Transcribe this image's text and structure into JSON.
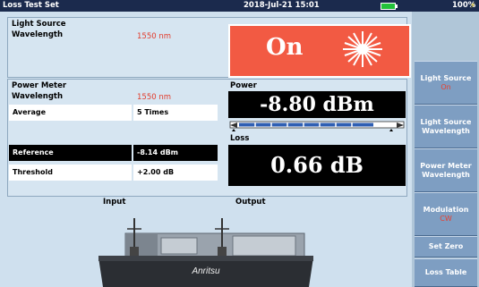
{
  "titlebar": {
    "title": "Loss Test Set",
    "datetime": "2018-Jul-21 15:01",
    "battery": "100%",
    "battery_fill": 1.0
  },
  "light_source": {
    "heading": "Light Source",
    "wavelength_label": "Wavelength",
    "wavelength_value": "1550 nm",
    "state": "On",
    "state_color": "#f25a43"
  },
  "power_meter": {
    "heading": "Power Meter",
    "wavelength_label": "Wavelength",
    "wavelength_value": "1550 nm",
    "average_label": "Average",
    "average_value": "5 Times",
    "reference_label": "Reference",
    "reference_value": "-8.14 dBm",
    "threshold_label": "Threshold",
    "threshold_value": "+2.00 dB"
  },
  "power": {
    "label": "Power",
    "value": "-8.80 dBm"
  },
  "loss": {
    "label": "Loss",
    "value": "0.66 dB"
  },
  "diagram": {
    "input_label": "Input",
    "output_label": "Output",
    "brand": "Anritsu"
  },
  "sidebar": {
    "items": [
      {
        "label": "Light Source",
        "value": "On"
      },
      {
        "label": "Light Source\nWavelength",
        "value": ""
      },
      {
        "label": "Power Meter\nWavelength",
        "value": ""
      },
      {
        "label": "Modulation",
        "value": "CW"
      },
      {
        "label": "Set Zero",
        "value": ""
      },
      {
        "label": "Loss Table",
        "value": ""
      }
    ]
  }
}
